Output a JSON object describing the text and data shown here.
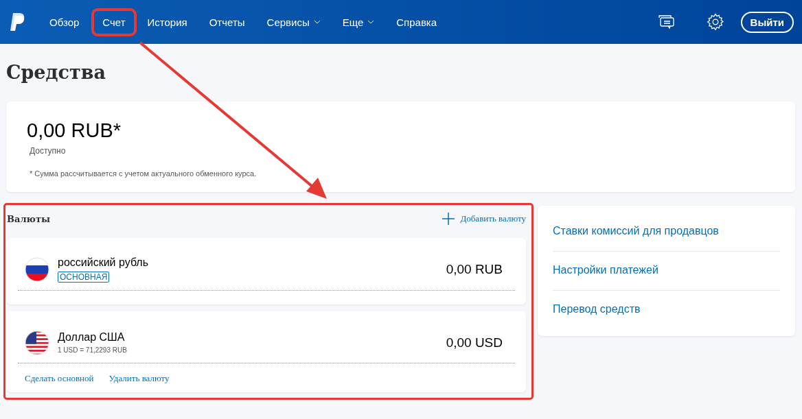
{
  "nav": {
    "items": [
      {
        "label": "Обзор",
        "dropdown": false,
        "highlighted": false
      },
      {
        "label": "Счет",
        "dropdown": false,
        "highlighted": true
      },
      {
        "label": "История",
        "dropdown": false,
        "highlighted": false
      },
      {
        "label": "Отчеты",
        "dropdown": false,
        "highlighted": false
      },
      {
        "label": "Сервисы",
        "dropdown": true,
        "highlighted": false
      },
      {
        "label": "Еще",
        "dropdown": true,
        "highlighted": false
      },
      {
        "label": "Справка",
        "dropdown": false,
        "highlighted": false
      }
    ],
    "logout": "Выйти"
  },
  "page_title": "Средства",
  "balance": {
    "amount": "0,00 RUB*",
    "caption": "Доступно",
    "note": "* Сумма рассчитывается с учетом актуального обменного курса."
  },
  "currencies": {
    "title": "Валюты",
    "add": "Добавить валюту",
    "highlighted": true,
    "items": [
      {
        "kind": "ru",
        "name": "российский рубль",
        "badge": "ОСНОВНАЯ",
        "amount": "0,00 RUB"
      },
      {
        "kind": "us",
        "name": "Доллар США",
        "rate": "1 USD = 71,2293 RUB",
        "amount": "0,00 USD",
        "actions": [
          "Сделать основной",
          "Удалить валюту"
        ]
      }
    ]
  },
  "links": [
    "Ставки комиссий для продавцов",
    "Настройки платежей",
    "Перевод средств"
  ]
}
